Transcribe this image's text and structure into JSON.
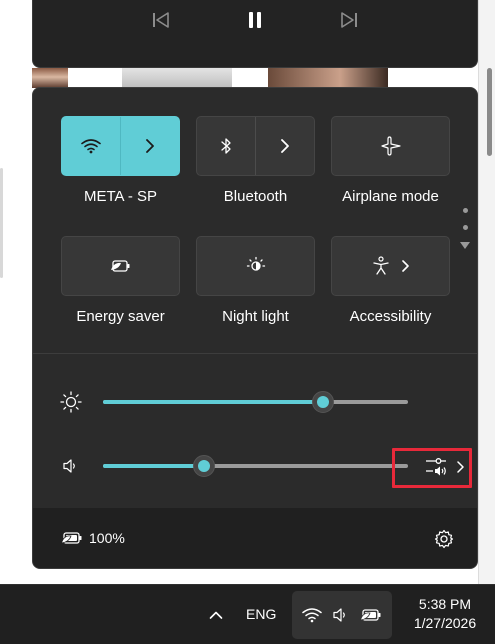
{
  "media": {
    "controls": [
      "previous-track",
      "pause",
      "next-track"
    ]
  },
  "quick_settings": {
    "tiles": [
      {
        "label": "META - SP",
        "icon": "wifi-icon",
        "state": "on"
      },
      {
        "label": "Bluetooth",
        "icon": "bluetooth-icon",
        "state": "off"
      },
      {
        "label": "Airplane mode",
        "icon": "airplane-icon",
        "state": "off"
      },
      {
        "label": "Energy saver",
        "icon": "energy-saver-icon",
        "state": "off"
      },
      {
        "label": "Night light",
        "icon": "night-light-icon",
        "state": "off"
      },
      {
        "label": "Accessibility",
        "icon": "accessibility-icon",
        "state": "off"
      }
    ],
    "brightness_percent": 72,
    "volume_percent": 33,
    "battery_text": "100%"
  },
  "taskbar": {
    "language": "ENG",
    "time": "5:38 PM",
    "date": "1/27/2026"
  },
  "colors": {
    "accent": "#60cdd6",
    "panel": "#2b2b2b",
    "highlight": "#e8293a"
  }
}
